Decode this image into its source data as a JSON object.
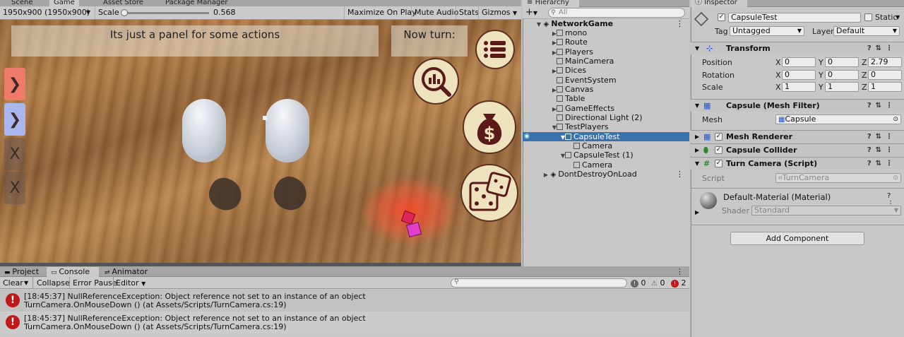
{
  "scene_tabs": {
    "scene": "Scene",
    "game": "Game",
    "asset_store": "Asset Store",
    "package_manager": "Package Manager"
  },
  "game_toolbar": {
    "resolution": "1950x900 (1950x900)",
    "scale_label": "Scale",
    "scale_value": "0.568",
    "maximize": "Maximize On Play",
    "mute": "Mute Audio",
    "stats": "Stats",
    "gizmos": "Gizmos"
  },
  "game_view": {
    "panel_text": "Its  just a panel for some actions",
    "now_turn": "Now turn:"
  },
  "hierarchy": {
    "tab": "Hierarchy",
    "search_placeholder": "All",
    "items": [
      {
        "label": "NetworkGame"
      },
      {
        "label": "mono"
      },
      {
        "label": "Route"
      },
      {
        "label": "Players"
      },
      {
        "label": "MainCamera"
      },
      {
        "label": "Dices"
      },
      {
        "label": "EventSystem"
      },
      {
        "label": "Canvas"
      },
      {
        "label": "Table"
      },
      {
        "label": "GameEffects"
      },
      {
        "label": "Directional Light (2)"
      },
      {
        "label": "TestPlayers"
      },
      {
        "label": "CapsuleTest"
      },
      {
        "label": "Camera"
      },
      {
        "label": "CapsuleTest (1)"
      },
      {
        "label": "Camera"
      },
      {
        "label": "DontDestroyOnLoad"
      }
    ]
  },
  "inspector": {
    "tab": "Inspector",
    "object_name": "CapsuleTest",
    "static_label": "Static",
    "tag_label": "Tag",
    "tag_value": "Untagged",
    "layer_label": "Layer",
    "layer_value": "Default",
    "transform": {
      "title": "Transform",
      "position_label": "Position",
      "rotation_label": "Rotation",
      "scale_label": "Scale",
      "x": "X",
      "y": "Y",
      "z": "Z",
      "position": [
        "0",
        "0",
        "2.79"
      ],
      "rotation": [
        "0",
        "0",
        "0"
      ],
      "scale": [
        "1",
        "1",
        "1"
      ]
    },
    "mesh_filter": {
      "title": "Capsule (Mesh Filter)",
      "mesh_label": "Mesh",
      "mesh_value": "Capsule"
    },
    "mesh_renderer": "Mesh Renderer",
    "capsule_collider": "Capsule Collider",
    "turn_camera": {
      "title": "Turn Camera (Script)",
      "script_label": "Script",
      "script_value": "TurnCamera"
    },
    "material": {
      "title": "Default-Material (Material)",
      "shader_label": "Shader",
      "shader_value": "Standard"
    },
    "add_component": "Add Component"
  },
  "console": {
    "tabs": [
      "Project",
      "Console",
      "Animator"
    ],
    "clear": "Clear",
    "collapse": "Collapse",
    "error_pause": "Error Pause",
    "editor": "Editor",
    "info_count": "0",
    "warn_count": "0",
    "error_count": "2",
    "messages": [
      {
        "line1": "[18:45:37] NullReferenceException: Object reference not set to an instance of an object",
        "line2": "TurnCamera.OnMouseDown () (at Assets/Scripts/TurnCamera.cs:19)"
      },
      {
        "line1": "[18:45:37] NullReferenceException: Object reference not set to an instance of an object",
        "line2": "TurnCamera.OnMouseDown () (at Assets/Scripts/TurnCamera.cs:19)"
      }
    ]
  }
}
